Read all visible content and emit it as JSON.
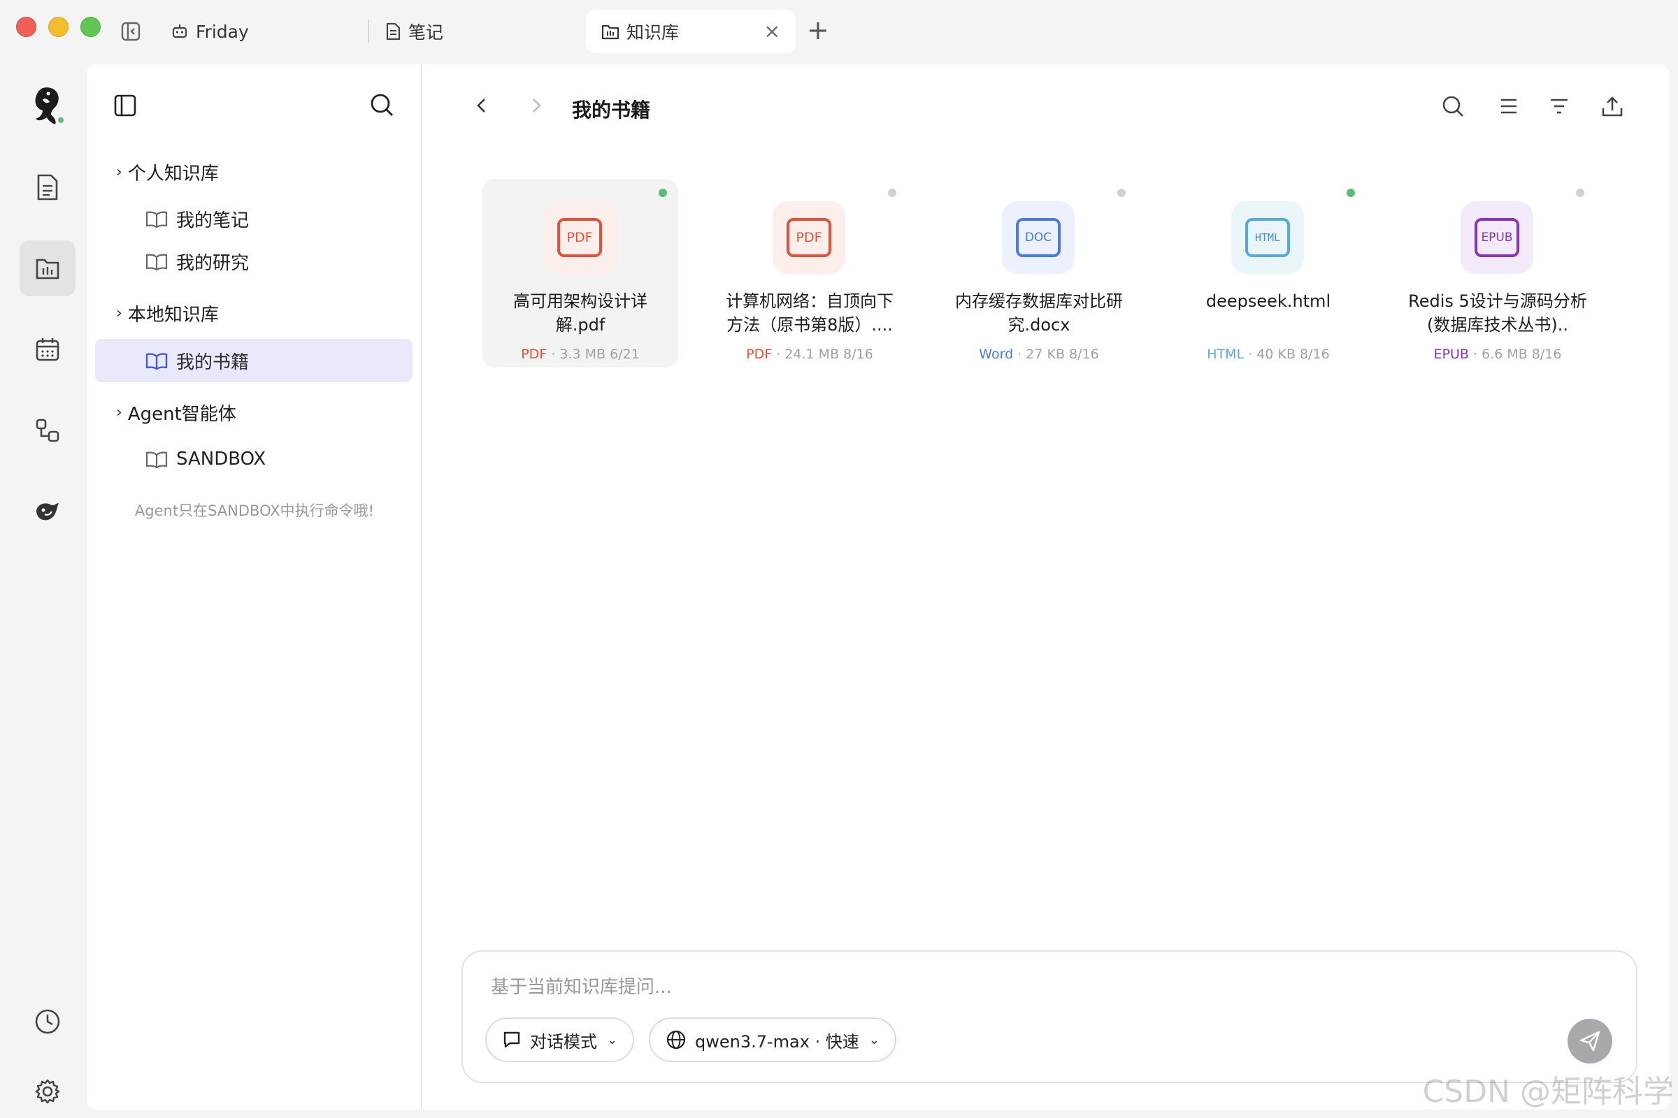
{
  "tabs": [
    {
      "label": "Friday",
      "icon": "robot-icon"
    },
    {
      "label": "笔记",
      "icon": "document-icon"
    },
    {
      "label": "知识库",
      "icon": "knowledge-icon",
      "active": true
    }
  ],
  "sidebar": {
    "groups": [
      {
        "label": "个人知识库",
        "items": [
          {
            "label": "我的笔记"
          },
          {
            "label": "我的研究"
          }
        ]
      },
      {
        "label": "本地知识库",
        "items": [
          {
            "label": "我的书籍",
            "active": true
          }
        ]
      },
      {
        "label": "Agent智能体",
        "items": [
          {
            "label": "SANDBOX"
          }
        ]
      }
    ],
    "note": "Agent只在SANDBOX中执行命令哦!"
  },
  "main": {
    "title": "我的书籍",
    "files": [
      {
        "name": "高可用架构设计详解.pdf",
        "badge": "PDF",
        "type": "PDF",
        "size": "3.3 MB",
        "date": "6/21",
        "status_color": "#5bbd72",
        "accent": "#d9543d",
        "bg": "#fbeeeb",
        "selected": true
      },
      {
        "name": "计算机网络：自顶向下方法（原书第8版）....",
        "badge": "PDF",
        "type": "PDF",
        "size": "24.1 MB",
        "date": "8/16",
        "status_color": "#cfd0d8",
        "accent": "#d9543d",
        "bg": "#fbeeeb"
      },
      {
        "name": "内存缓存数据库对比研究.docx",
        "badge": "DOC",
        "type": "Word",
        "size": "27 KB",
        "date": "8/16",
        "status_color": "#cfd0d8",
        "accent": "#4a7bd8",
        "bg": "#ecf1fd"
      },
      {
        "name": "deepseek.html",
        "badge": "HTML",
        "type": "HTML",
        "size": "40 KB",
        "date": "8/16",
        "status_color": "#5bbd72",
        "accent": "#5aa8d4",
        "bg": "#eaf5fa"
      },
      {
        "name": "Redis 5设计与源码分析 (数据库技术丛书)..",
        "badge": "EPUB",
        "type": "EPUB",
        "size": "6.6 MB",
        "date": "8/16",
        "status_color": "#cfd0d8",
        "accent": "#8a35b4",
        "bg": "#f4ebfa"
      }
    ]
  },
  "chat": {
    "placeholder": "基于当前知识库提问...",
    "mode_label": "对话模式",
    "model_label": "qwen3.7-max · 快速"
  },
  "watermark": "CSDN @矩阵科学"
}
